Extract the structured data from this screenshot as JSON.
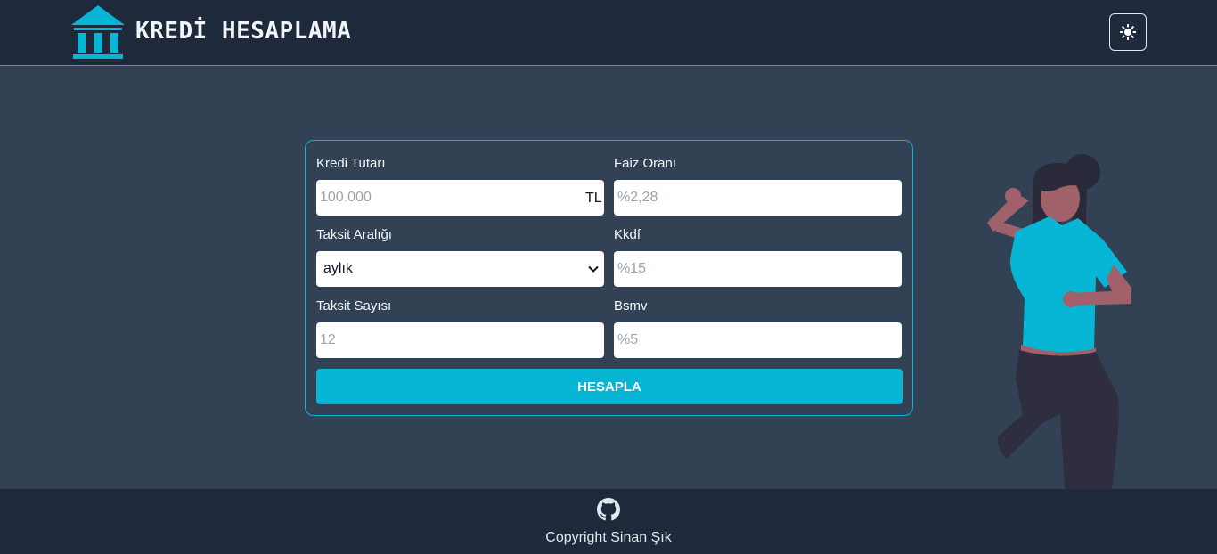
{
  "header": {
    "brand": "KREDİ HESAPLAMA",
    "logo_icon": "bank-icon",
    "theme_toggle_icon": "sun-icon"
  },
  "form": {
    "loan_amount": {
      "label": "Kredi Tutarı",
      "placeholder": "100.000",
      "suffix": "TL"
    },
    "interest_rate": {
      "label": "Faiz Oranı",
      "placeholder": "%2,28"
    },
    "installment_interval": {
      "label": "Taksit Aralığı",
      "value": "aylık"
    },
    "kkdf": {
      "label": "Kkdf",
      "placeholder": "%15"
    },
    "installment_count": {
      "label": "Taksit Sayısı",
      "placeholder": "12"
    },
    "bsmv": {
      "label": "Bsmv",
      "placeholder": "%5"
    },
    "submit_label": "HESAPLA"
  },
  "footer": {
    "github_icon": "github-icon",
    "copyright": "Copyright Sinan Şık"
  },
  "colors": {
    "accent": "#06b6d4",
    "header_bg": "#1e293b",
    "page_bg": "#334155"
  }
}
